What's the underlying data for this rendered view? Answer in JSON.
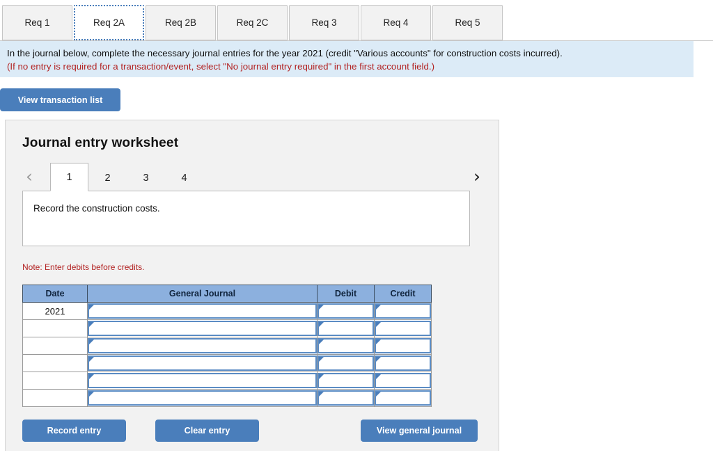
{
  "req_tabs": {
    "active_index": 1,
    "items": [
      {
        "label": "Req 1"
      },
      {
        "label": "Req 2A"
      },
      {
        "label": "Req 2B"
      },
      {
        "label": "Req 2C"
      },
      {
        "label": "Req 3"
      },
      {
        "label": "Req 4"
      },
      {
        "label": "Req 5"
      }
    ]
  },
  "instructions": {
    "main": "In the journal below, complete the necessary journal entries for the year 2021 (credit \"Various accounts\" for construction costs incurred).",
    "note": "(If no entry is required for a transaction/event, select \"No journal entry required\" in the first account field.)"
  },
  "toolbar": {
    "view_transaction_list_label": "View transaction list"
  },
  "worksheet": {
    "title": "Journal entry worksheet",
    "pager": {
      "prev_icon": "chevron-left-icon",
      "next_icon": "chevron-right-icon",
      "prev_glyph": "‹",
      "next_glyph": "›",
      "active_page": "1",
      "pages": [
        "1",
        "2",
        "3",
        "4"
      ]
    },
    "transaction": {
      "description": "Record the construction costs."
    },
    "note": "Note: Enter debits before credits.",
    "table": {
      "headers": [
        "Date",
        "General Journal",
        "Debit",
        "Credit"
      ],
      "rows": [
        {
          "date": "2021",
          "general_journal": "",
          "debit": "",
          "credit": ""
        },
        {
          "date": "",
          "general_journal": "",
          "debit": "",
          "credit": ""
        },
        {
          "date": "",
          "general_journal": "",
          "debit": "",
          "credit": ""
        },
        {
          "date": "",
          "general_journal": "",
          "debit": "",
          "credit": ""
        },
        {
          "date": "",
          "general_journal": "",
          "debit": "",
          "credit": ""
        },
        {
          "date": "",
          "general_journal": "",
          "debit": "",
          "credit": ""
        }
      ]
    },
    "buttons": {
      "record_entry": "Record entry",
      "clear_entry": "Clear entry",
      "view_general_journal": "View general journal"
    }
  },
  "colors": {
    "accent_blue": "#4a7ebb",
    "table_header_blue": "#8cb0de",
    "banner_blue": "#dcebf7",
    "warning_red": "#b22222",
    "panel_gray": "#f2f2f2"
  }
}
